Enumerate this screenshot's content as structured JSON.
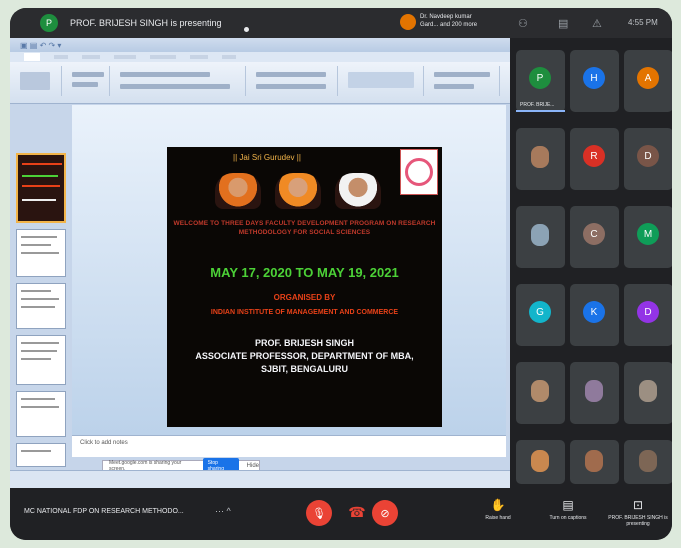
{
  "topbar": {
    "presenter_initial": "P",
    "presenter_text": "PROF. BRIJESH SINGH is presenting",
    "joined_text": "Dr. Navdeep kumar Gard... and 200 more",
    "clock": "4:55 PM"
  },
  "slide": {
    "gurudev": "|| Jai Sri Gurudev ||",
    "welcome": "WELCOME TO THREE DAYS FACULTY DEVELOPMENT PROGRAM ON RESEARCH METHODOLOGY FOR SOCIAL SCIENCES",
    "dates": "MAY 17, 2020 TO MAY 19, 2021",
    "organised": "ORGANISED BY",
    "institute": "INDIAN INSTITUTE OF MANAGEMENT AND COMMERCE",
    "prof": "PROF. BRIJESH SINGH",
    "designation": "ASSOCIATE PROFESSOR, DEPARTMENT OF MBA,",
    "college": "SJBIT, BENGALURU"
  },
  "ppt": {
    "notes_placeholder": "Click to add notes",
    "notify_text": "Meet.google.com is sharing your screen.",
    "notify_button": "Stop sharing",
    "notify_hide": "Hide"
  },
  "participants": [
    {
      "initial": "P",
      "color": "#1e8e3e",
      "name": "PROF. BRIJE..."
    },
    {
      "initial": "H",
      "color": "#1a73e8",
      "name": ""
    },
    {
      "initial": "A",
      "color": "#e37400",
      "name": ""
    },
    {
      "initial": "",
      "color": "",
      "name": ""
    },
    {
      "initial": "R",
      "color": "#d93025",
      "name": ""
    },
    {
      "initial": "D",
      "color": "#795548",
      "name": ""
    },
    {
      "initial": "",
      "color": "",
      "name": ""
    },
    {
      "initial": "C",
      "color": "#8d6e63",
      "name": ""
    },
    {
      "initial": "M",
      "color": "#0f9d58",
      "name": ""
    },
    {
      "initial": "G",
      "color": "#12b5cb",
      "name": ""
    },
    {
      "initial": "K",
      "color": "#1a73e8",
      "name": ""
    },
    {
      "initial": "D",
      "color": "#9334e6",
      "name": ""
    },
    {
      "initial": "",
      "color": "",
      "name": ""
    },
    {
      "initial": "",
      "color": "",
      "name": ""
    },
    {
      "initial": "",
      "color": "",
      "name": ""
    },
    {
      "initial": "",
      "color": "",
      "name": ""
    },
    {
      "initial": "",
      "color": "",
      "name": ""
    },
    {
      "initial": "",
      "color": "",
      "name": ""
    }
  ],
  "bottombar": {
    "meeting_name": "MC NATIONAL FDP ON RESEARCH METHODO...",
    "raise_hand": "Raise hand",
    "captions": "Turn on captions",
    "presenting": "PROF. BRIJESH SINGH is presenting"
  }
}
